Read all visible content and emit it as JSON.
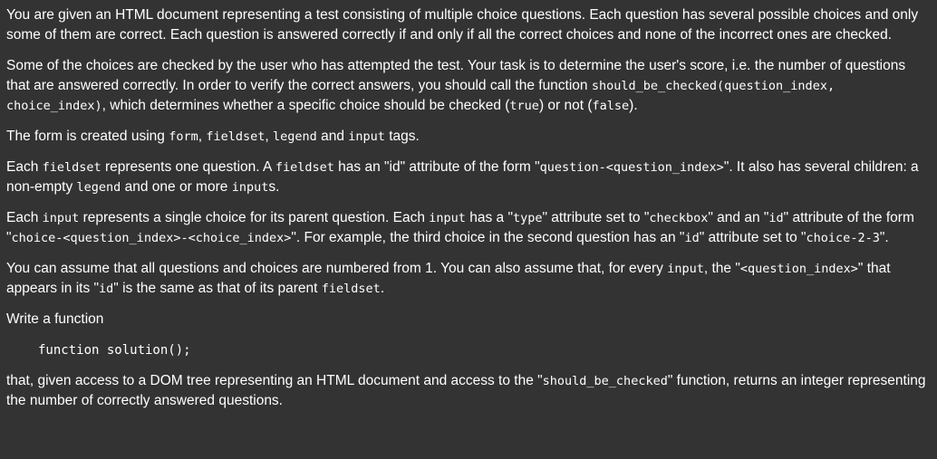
{
  "paragraphs": {
    "p1": {
      "text": "You are given an HTML document representing a test consisting of multiple choice questions. Each question has several possible choices and only some of them are correct. Each question is answered correctly if and only if all the correct choices and none of the incorrect ones are checked."
    },
    "p2": {
      "t1": "Some of the choices are checked by the user who has attempted the test. Your task is to determine the user's score, i.e. the number of questions that are answered correctly. In order to verify the correct answers, you should call the function ",
      "c1": "should_be_checked(question_index, choice_index)",
      "t2": ", which determines whether a specific choice should be checked (",
      "c2": "true",
      "t3": ") or not (",
      "c3": "false",
      "t4": ")."
    },
    "p3": {
      "t1": "The form is created using ",
      "c1": "form",
      "t2": ", ",
      "c2": "fieldset",
      "t3": ", ",
      "c3": "legend",
      "t4": " and ",
      "c4": "input",
      "t5": " tags."
    },
    "p4": {
      "t1": "Each ",
      "c1": "fieldset",
      "t2": " represents one question. A ",
      "c2": "fieldset",
      "t3": " has an \"id\" attribute of the form \"",
      "c3": "question-<question_index>",
      "t4": "\". It also has several children: a non-empty ",
      "c4": "legend",
      "t5": " and one or more ",
      "c5": "input",
      "t6": "s."
    },
    "p5": {
      "t1": "Each ",
      "c1": "input",
      "t2": " represents a single choice for its parent question. Each ",
      "c2": "input",
      "t3": " has a \"",
      "c3": "type",
      "t4": "\" attribute set to \"",
      "c4": "checkbox",
      "t5": "\" and an \"",
      "c5": "id",
      "t6": "\" attribute of the form \"",
      "c6": "choice-<question_index>-<choice_index>",
      "t7": "\". For example, the third choice in the second question has an \"",
      "c7": "id",
      "t8": "\" attribute set to \"",
      "c8": "choice-2-3",
      "t9": "\"."
    },
    "p6": {
      "t1": "You can assume that all questions and choices are numbered from 1. You can also assume that, for every ",
      "c1": "input",
      "t2": ", the \"",
      "c2": "<question_index>",
      "t3": "\" that appears in its \"",
      "c3": "id",
      "t4": "\" is the same as that of its parent ",
      "c4": "fieldset",
      "t5": "."
    },
    "p7": {
      "text": "Write a function"
    },
    "code_block": "function solution();",
    "p8": {
      "t1": "that, given access to a DOM tree representing an HTML document and access to the \"",
      "c1": "should_be_checked",
      "t2": "\" function, returns an integer representing the number of correctly answered questions."
    }
  }
}
